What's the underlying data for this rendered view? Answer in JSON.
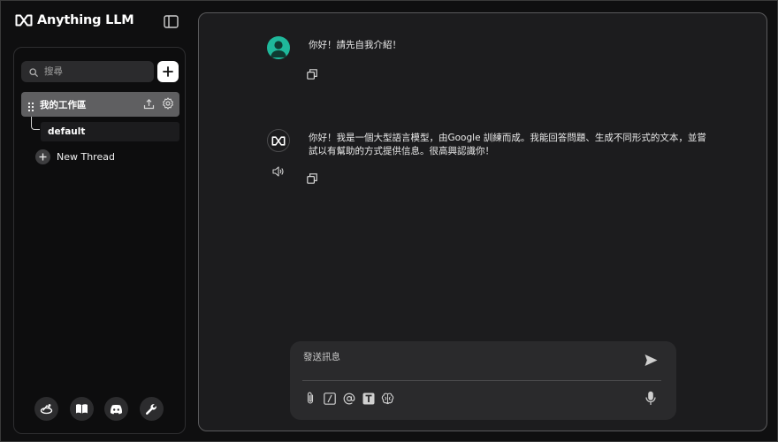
{
  "app": {
    "name": "Anything LLM"
  },
  "sidebar": {
    "search_placeholder": "搜尋",
    "workspace": {
      "name": "我的工作區"
    },
    "threads": [
      {
        "name": "default"
      }
    ],
    "new_thread_label": "New Thread",
    "footer_icons": [
      "community-hub-icon",
      "docs-book-icon",
      "discord-icon",
      "settings-wrench-icon"
    ]
  },
  "chat": {
    "messages": [
      {
        "role": "user",
        "text": "你好！請先自我介紹！"
      },
      {
        "role": "assistant",
        "text": "你好！我是一個大型語言模型，由Google 訓練而成。我能回答問題、生成不同形式的文本，並嘗試以有幫助的方式提供信息。很高興認識你！"
      }
    ]
  },
  "composer": {
    "placeholder": "發送訊息",
    "tool_icons": [
      "attach-icon",
      "slash-command-icon",
      "at-mention-icon",
      "text-size-icon",
      "agent-brain-icon"
    ]
  },
  "colors": {
    "background": "#0f0f10",
    "panel": "#1c1c1e",
    "user_avatar": "#1fb89b",
    "workspace_active": "#5f5f61"
  }
}
